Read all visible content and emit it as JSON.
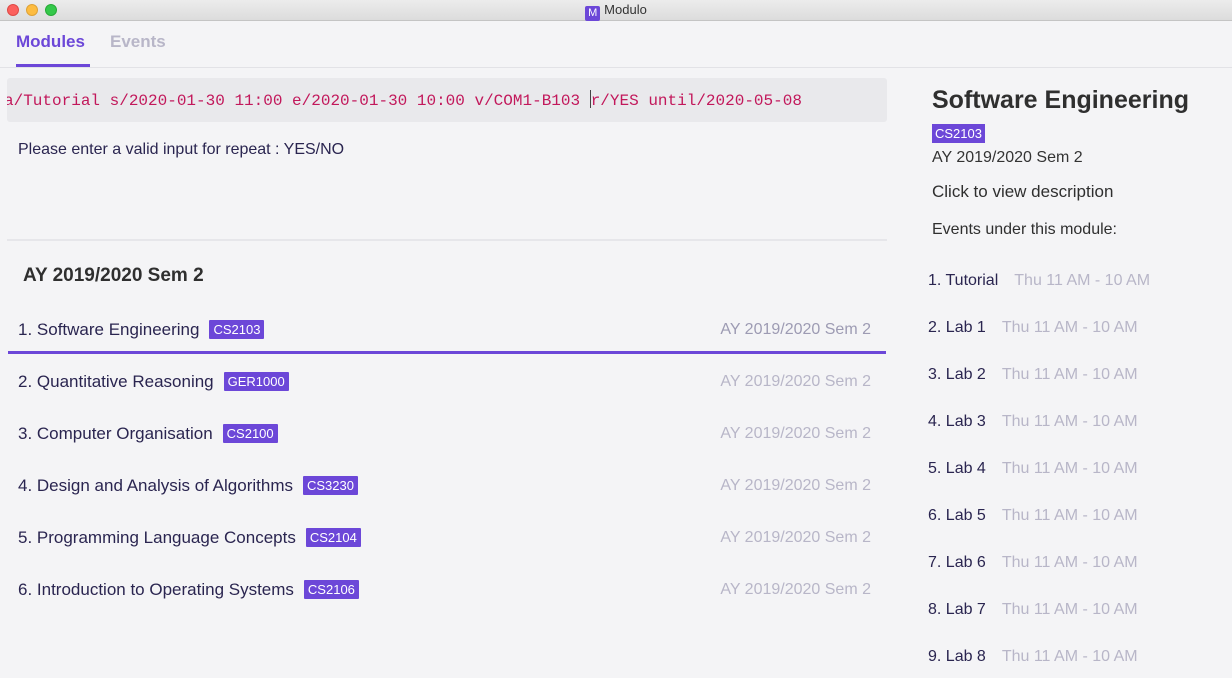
{
  "window": {
    "title": "Modulo",
    "icon_letter": "M"
  },
  "tabs": [
    {
      "label": "Modules"
    },
    {
      "label": "Events"
    }
  ],
  "command": {
    "text_before_caret": "а/Tutorial s/2020-01-30 11:00 e/2020-01-30 10:00 v/COM1-B103 ",
    "text_after_caret": "r/YES until/2020-05-08"
  },
  "feedback": "Please enter a valid input for repeat : YES/NO",
  "module_list": {
    "semester_title": "AY 2019/2020 Sem 2",
    "modules": [
      {
        "name": "1. Software Engineering",
        "code": "CS2103",
        "semester": "AY 2019/2020 Sem 2"
      },
      {
        "name": "2. Quantitative Reasoning",
        "code": "GER1000",
        "semester": "AY 2019/2020 Sem 2"
      },
      {
        "name": "3. Computer Organisation",
        "code": "CS2100",
        "semester": "AY 2019/2020 Sem 2"
      },
      {
        "name": "4. Design and Analysis of Algorithms",
        "code": "CS3230",
        "semester": "AY 2019/2020 Sem 2"
      },
      {
        "name": "5. Programming Language Concepts",
        "code": "CS2104",
        "semester": "AY 2019/2020 Sem 2"
      },
      {
        "name": "6. Introduction to Operating Systems",
        "code": "CS2106",
        "semester": "AY 2019/2020 Sem 2"
      }
    ]
  },
  "detail": {
    "title": "Software Engineering",
    "code": "CS2103",
    "semester": "AY 2019/2020 Sem 2",
    "description_link": "Click to view description",
    "events_label": "Events under this module:",
    "events": [
      {
        "name": "1. Tutorial",
        "time": "Thu 11 AM - 10 AM"
      },
      {
        "name": "2. Lab 1",
        "time": "Thu 11 AM - 10 AM"
      },
      {
        "name": "3. Lab 2",
        "time": "Thu 11 AM - 10 AM"
      },
      {
        "name": "4. Lab 3",
        "time": "Thu 11 AM - 10 AM"
      },
      {
        "name": "5. Lab 4",
        "time": "Thu 11 AM - 10 AM"
      },
      {
        "name": "6. Lab 5",
        "time": "Thu 11 AM - 10 AM"
      },
      {
        "name": "7. Lab 6",
        "time": "Thu 11 AM - 10 AM"
      },
      {
        "name": "8. Lab 7",
        "time": "Thu 11 AM - 10 AM"
      },
      {
        "name": "9. Lab 8",
        "time": "Thu 11 AM - 10 AM"
      }
    ]
  },
  "colors": {
    "accent": "#6c47d8",
    "command_text": "#c2185b",
    "muted": "#b8b6c8"
  }
}
